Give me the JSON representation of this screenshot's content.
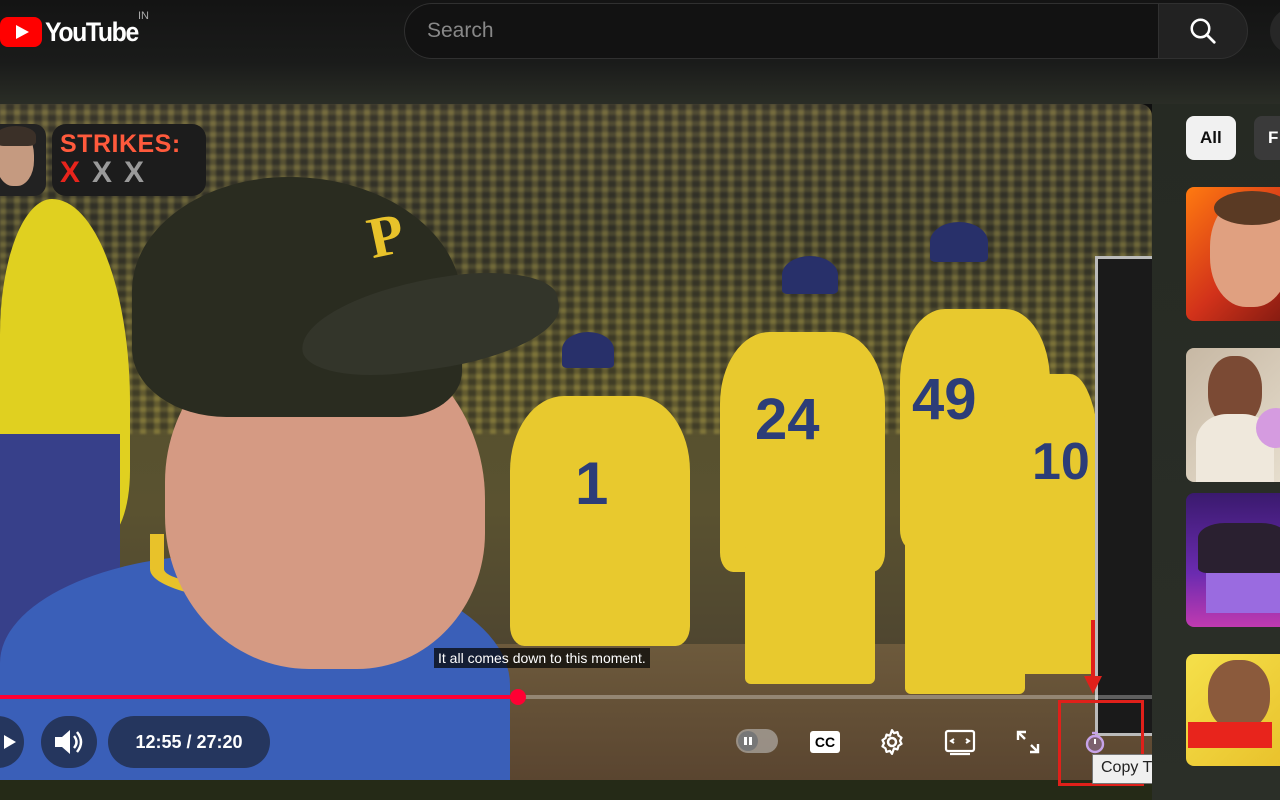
{
  "header": {
    "logo_text": "YouTube",
    "region": "IN",
    "search_placeholder": "Search"
  },
  "player": {
    "overlay": {
      "strikes_title": "STRIKES:",
      "strikes_marks": [
        "X",
        "X",
        "X"
      ]
    },
    "caption": "It all comes down to this moment.",
    "progress_fraction": 0.45,
    "time_display": "12:55 / 27:20",
    "cc_label": "CC",
    "tooltip": "Copy Timestamp Link"
  },
  "sidebar": {
    "chips": [
      "All",
      "F"
    ]
  },
  "colors": {
    "accent": "#ff0033",
    "brand_red": "#ff0000",
    "highlight": "#e0201a"
  }
}
